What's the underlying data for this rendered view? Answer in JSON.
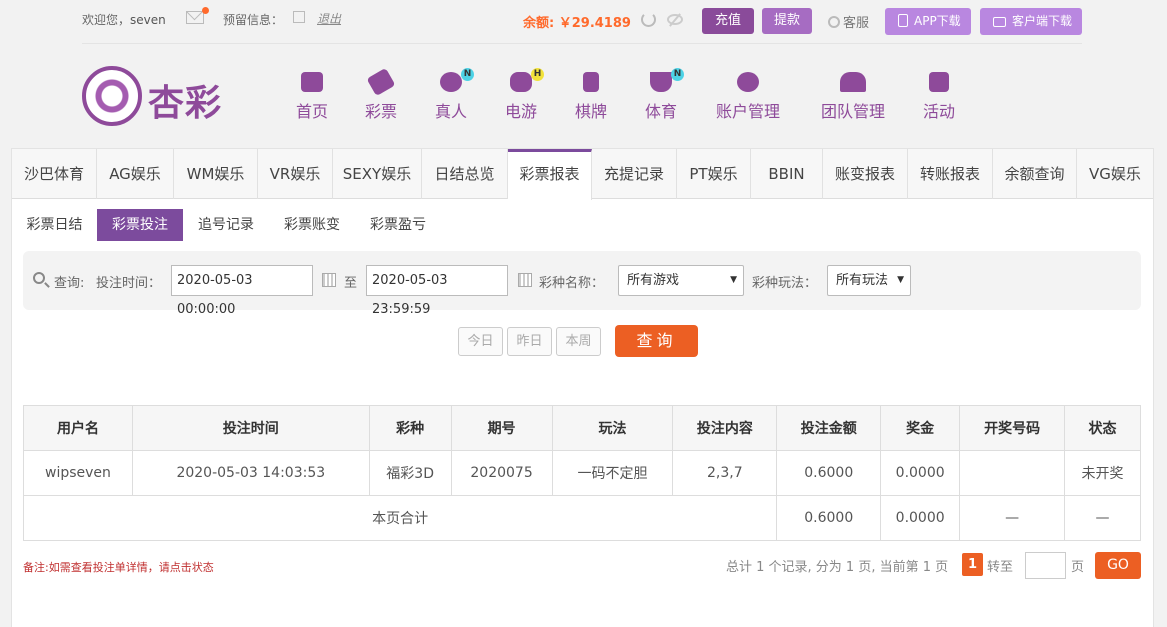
{
  "header": {
    "welcome_prefix": "欢迎您，",
    "username": "seven",
    "reserve_info": "预留信息：",
    "logout": "退出",
    "balance": "余额: ￥29.4189",
    "recharge": "充值",
    "withdraw": "提款",
    "service": "客服",
    "app_download": "APP下载",
    "client_download": "客户端下载"
  },
  "logo": {
    "text": "杏彩"
  },
  "nav": [
    {
      "label": "首页",
      "icon": "home-icon"
    },
    {
      "label": "彩票",
      "icon": "ticket-icon"
    },
    {
      "label": "真人",
      "icon": "live-dealer-icon",
      "badge": "N"
    },
    {
      "label": "电游",
      "icon": "gamepad-icon",
      "badge": "H"
    },
    {
      "label": "棋牌",
      "icon": "cards-icon"
    },
    {
      "label": "体育",
      "icon": "trophy-icon",
      "badge": "N"
    },
    {
      "label": "账户管理",
      "icon": "yen-icon"
    },
    {
      "label": "团队管理",
      "icon": "team-icon"
    },
    {
      "label": "活动",
      "icon": "gift-icon"
    }
  ],
  "tabs": [
    "沙巴体育",
    "AG娱乐",
    "WM娱乐",
    "VR娱乐",
    "SEXY娱乐",
    "日结总览",
    "彩票报表",
    "充提记录",
    "PT娱乐",
    "BBIN",
    "账变报表",
    "转账报表",
    "余额查询",
    "VG娱乐"
  ],
  "active_tab": "彩票报表",
  "subtabs": [
    "彩票日结",
    "彩票投注",
    "追号记录",
    "彩票账变",
    "彩票盈亏"
  ],
  "active_subtab": "彩票投注",
  "filter": {
    "query_label": "查询:",
    "time_label": "投注时间：",
    "start_time": "2020-05-03 00:00:00",
    "to_label": "至",
    "end_time": "2020-05-03 23:59:59",
    "lottery_label": "彩种名称：",
    "lottery_value": "所有游戏",
    "play_label": "彩种玩法：",
    "play_value": "所有玩法"
  },
  "quick": {
    "today": "今日",
    "yesterday": "昨日",
    "this_week": "本周",
    "query": "查询"
  },
  "table": {
    "headers": [
      "用户名",
      "投注时间",
      "彩种",
      "期号",
      "玩法",
      "投注内容",
      "投注金额",
      "奖金",
      "开奖号码",
      "状态"
    ],
    "row": {
      "username": "wipseven",
      "time": "2020-05-03 14:03:53",
      "lottery": "福彩3D",
      "issue": "2020075",
      "play": "一码不定胆",
      "content": "2,3,7",
      "amount": "0.6000",
      "prize": "0.0000",
      "draw_number": "",
      "status": "未开奖"
    },
    "total": {
      "label": "本页合计",
      "amount": "0.6000",
      "prize": "0.0000",
      "draw_number": "—",
      "status": "—"
    }
  },
  "note": "备注:如需查看投注单详情，请点击状态",
  "pager": {
    "summary": "总计 1 个记录, 分为 1 页, 当前第 1 页",
    "current": "1",
    "goto": "转至",
    "page_suffix": "页",
    "go": "GO"
  },
  "colors": {
    "brand": "#8e4a9a",
    "accent": "#ec5f23",
    "status_green": "#2a8a2a"
  }
}
